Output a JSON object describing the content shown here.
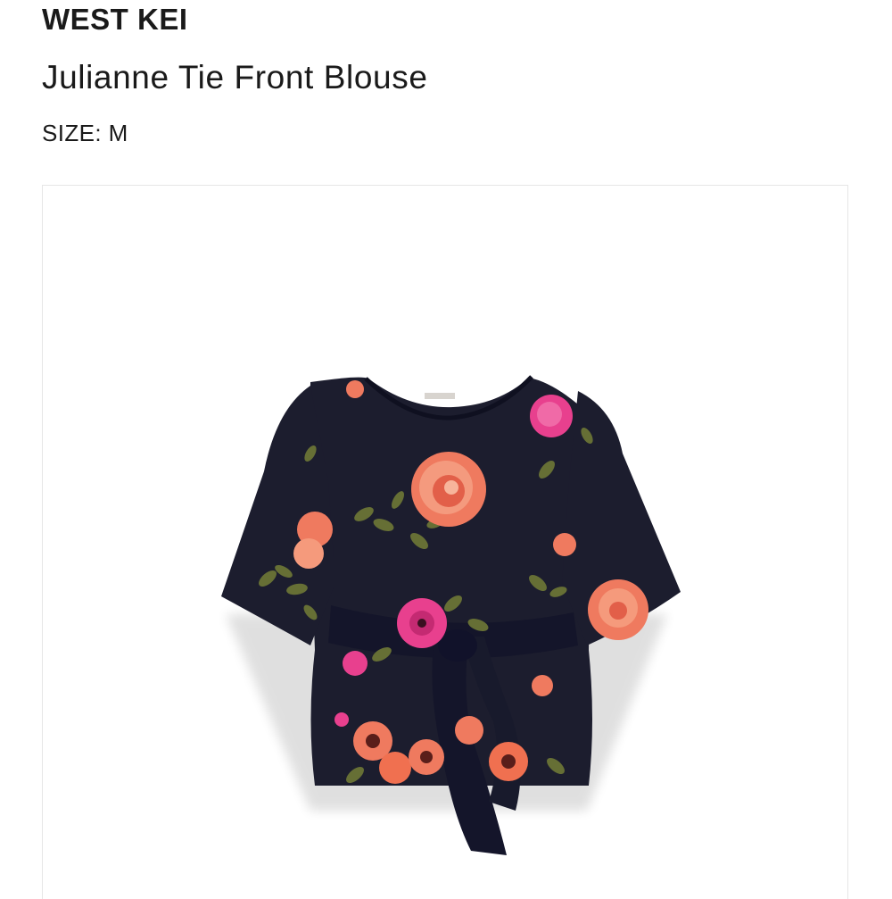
{
  "product": {
    "brand": "WEST KEI",
    "name": "Julianne Tie Front Blouse",
    "size_label": "SIZE: M"
  },
  "image": {
    "icon": "blouse-photo",
    "garment_color": "#1c1d2e",
    "accent_colors": [
      "#ef7a5f",
      "#e8408e",
      "#f59a7c",
      "#6b7436"
    ]
  }
}
